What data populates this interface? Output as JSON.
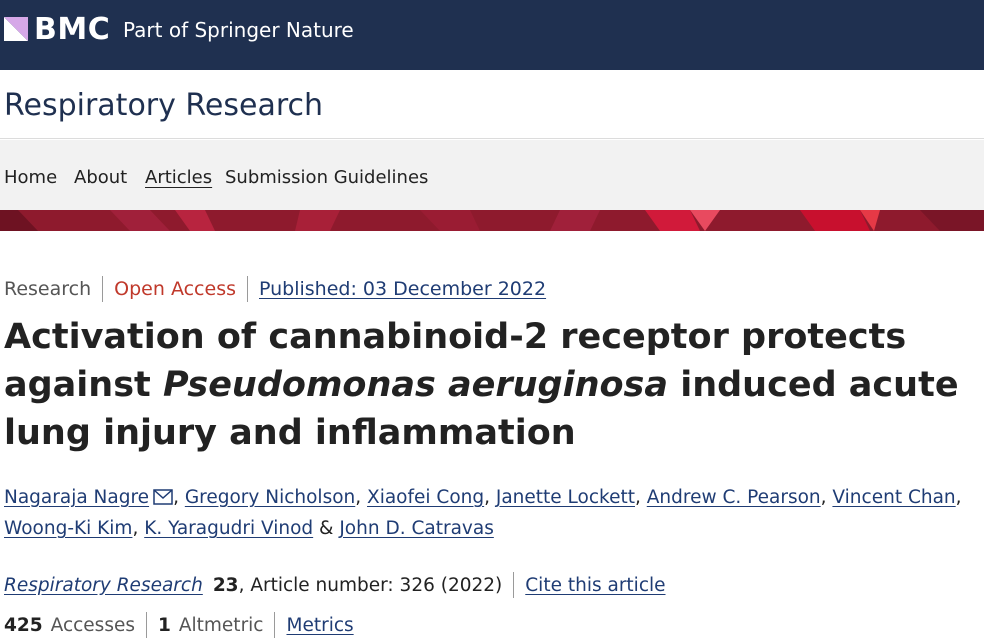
{
  "header": {
    "logo_text": "BMC",
    "logo_subtitle": "Part of Springer Nature",
    "brand_color": "#1f3050"
  },
  "journal": {
    "title": "Respiratory Research"
  },
  "nav": {
    "items": [
      {
        "label": "Home"
      },
      {
        "label": "About"
      },
      {
        "label": "Articles"
      },
      {
        "label": "Submission Guidelines"
      }
    ],
    "active": "Articles"
  },
  "banner": {
    "colors": [
      "#8e1a2d",
      "#c8102e",
      "#e63946"
    ]
  },
  "article": {
    "type": "Research",
    "access": "Open Access",
    "published": "Published: 03 December 2022",
    "title_part1": "Activation of cannabinoid-2 receptor protects against ",
    "title_italic": "Pseudomonas aeruginosa",
    "title_part2": " induced acute lung injury and inflammation",
    "authors": [
      {
        "name": "Nagaraja Nagre",
        "corresponding": true
      },
      {
        "name": "Gregory Nicholson"
      },
      {
        "name": "Xiaofei Cong"
      },
      {
        "name": "Janette Lockett"
      },
      {
        "name": "Andrew C. Pearson"
      },
      {
        "name": "Vincent Chan"
      },
      {
        "name": "Woong-Ki Kim"
      },
      {
        "name": "K. Yaragudri Vinod"
      },
      {
        "name": "John D. Catravas"
      }
    ],
    "author_separator": ", ",
    "author_last_separator": " & ",
    "citation": {
      "journal": "Respiratory Research",
      "volume": "23",
      "article_number": ", Article number: 326 (2022)",
      "cite_link": "Cite this article"
    },
    "metrics": {
      "accesses_count": "425",
      "accesses_label": "Accesses",
      "altmetric_count": "1",
      "altmetric_label": "Altmetric",
      "metrics_link": "Metrics"
    }
  },
  "icons": {
    "corresponding_author": "mail-icon",
    "logo": "bmc-logo-icon"
  }
}
